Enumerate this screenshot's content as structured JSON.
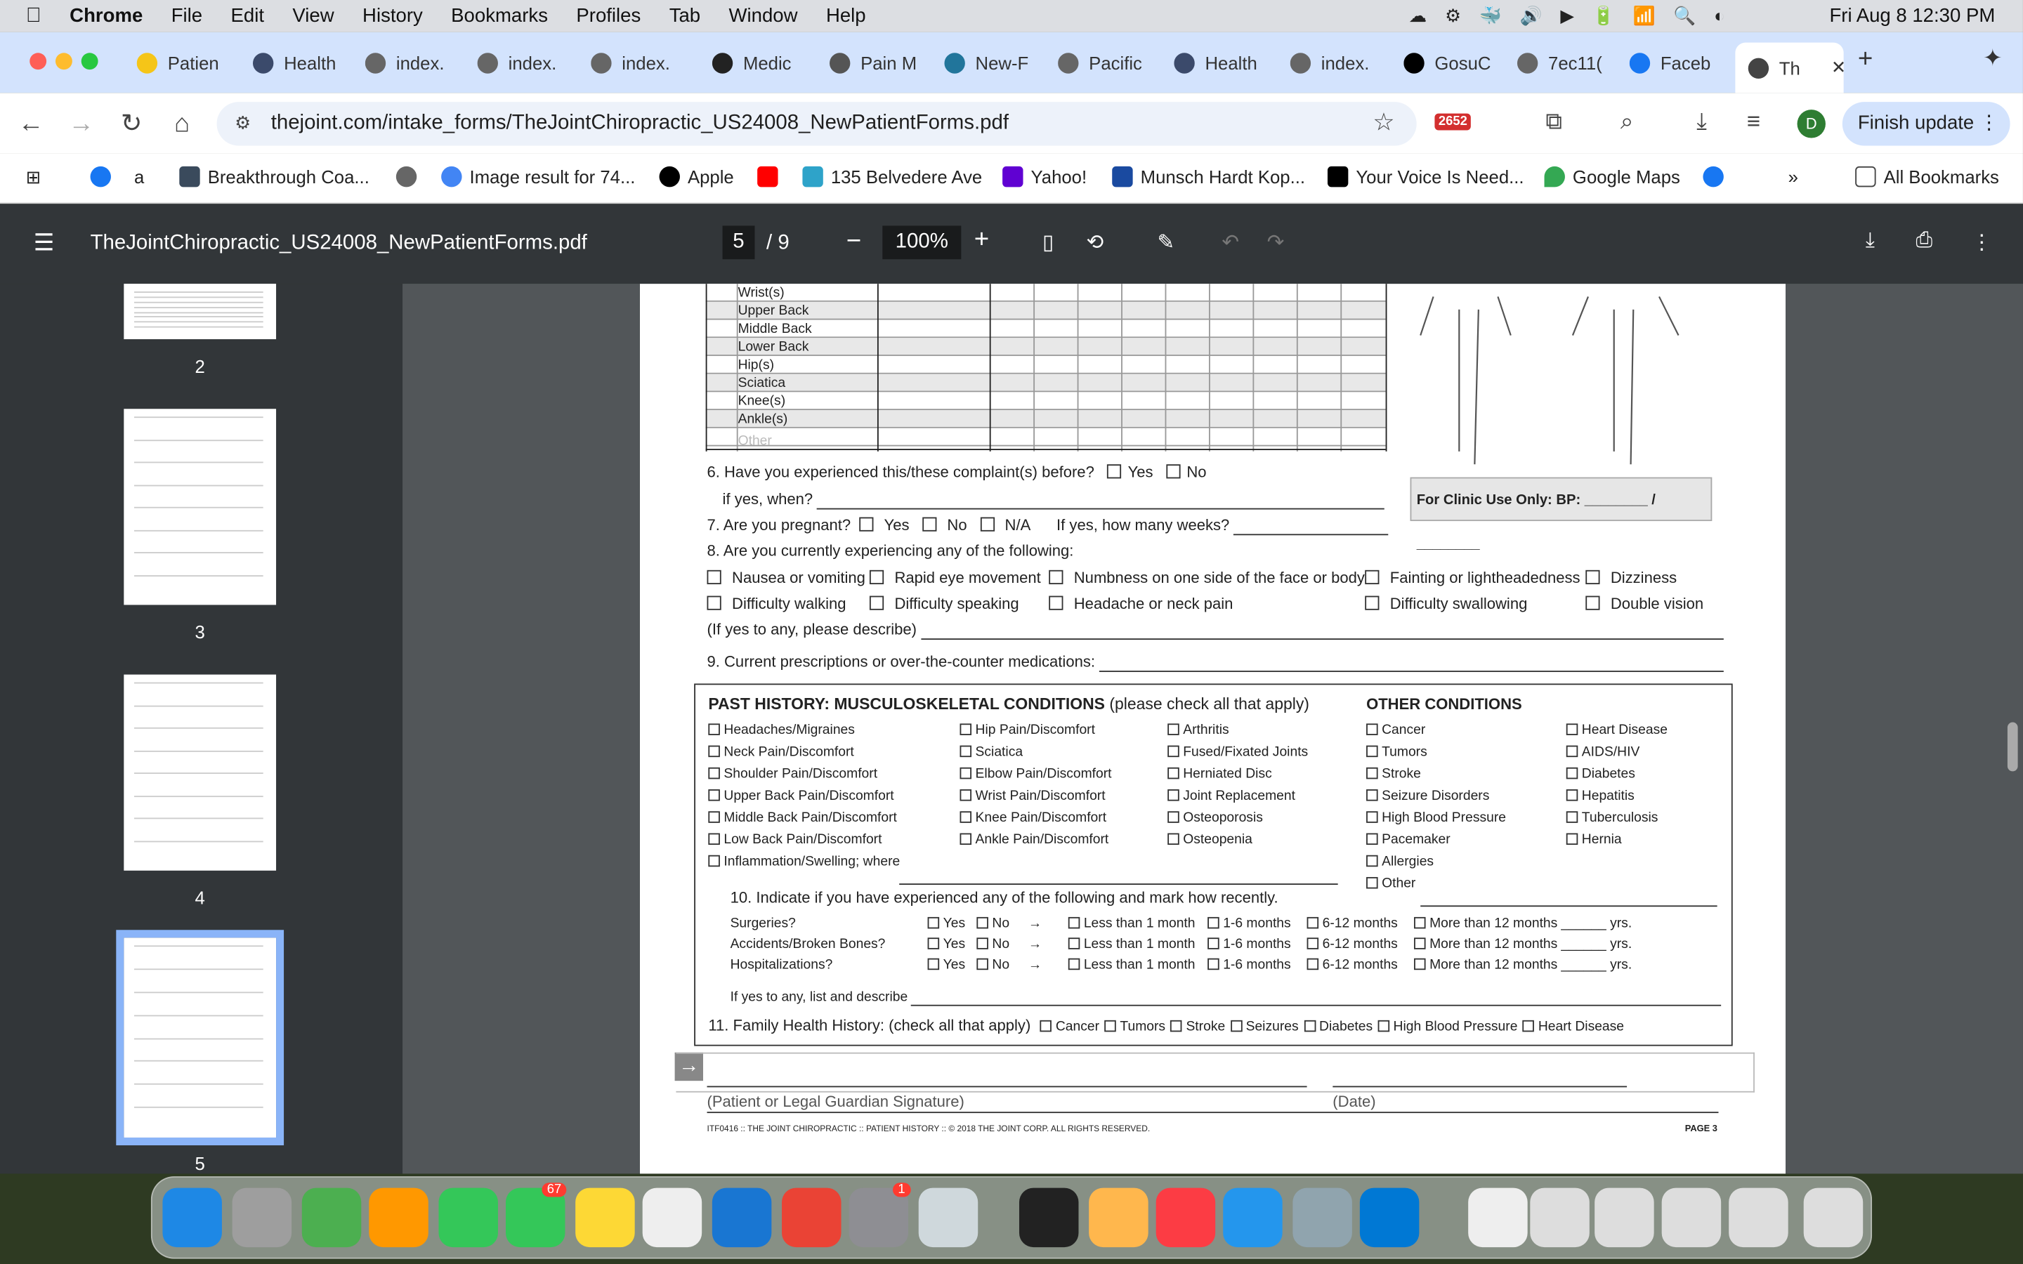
{
  "menubar": {
    "app": "Chrome",
    "items": [
      "File",
      "Edit",
      "View",
      "History",
      "Bookmarks",
      "Profiles",
      "Tab",
      "Window",
      "Help"
    ],
    "clock": "Fri Aug 8  12:30 PM"
  },
  "tabs": [
    {
      "label": "Patien",
      "color": "#f5c518"
    },
    {
      "label": "Health",
      "color": "#3b4a6b"
    },
    {
      "label": "index.",
      "color": "#666"
    },
    {
      "label": "index.",
      "color": "#666"
    },
    {
      "label": "index.",
      "color": "#666"
    },
    {
      "label": "Medic",
      "color": "#222"
    },
    {
      "label": "Pain M",
      "color": "#555"
    },
    {
      "label": "New-F",
      "color": "#21759b"
    },
    {
      "label": "Pacific",
      "color": "#666"
    },
    {
      "label": "Health",
      "color": "#3b4a6b"
    },
    {
      "label": "index.",
      "color": "#666"
    },
    {
      "label": "GosuC",
      "color": "#000"
    },
    {
      "label": "7ec11(",
      "color": "#666"
    },
    {
      "label": "Faceb",
      "color": "#1877f2"
    },
    {
      "label": "Th",
      "color": "#444"
    }
  ],
  "address": {
    "url": "thejoint.com/intake_forms/TheJointChiropractic_US24008_NewPatientForms.pdf",
    "ext_badge": "2652",
    "update_btn": "Finish update",
    "profile": "D"
  },
  "bookmarks": [
    "Breakthrough Coa...",
    "Image result for 74...",
    "Apple",
    "135 Belvedere Ave",
    "Yahoo!",
    "Munsch Hardt Kop...",
    "Your Voice Is Need...",
    "Google Maps"
  ],
  "bookmarks_all": "All Bookmarks",
  "pdf": {
    "filename": "TheJointChiropractic_US24008_NewPatientForms.pdf",
    "page": "5",
    "total": "/  9",
    "zoom": "100%"
  },
  "thumbs": [
    "2",
    "3",
    "4",
    "5"
  ],
  "form": {
    "body_rows": [
      "Wrist(s)",
      "Upper Back",
      "Middle Back",
      "Lower Back",
      "Hip(s)",
      "Sciatica",
      "Knee(s)",
      "Ankle(s)",
      "Other"
    ],
    "q6": "6. Have you experienced this/these complaint(s) before?",
    "yes": "Yes",
    "no": "No",
    "q6b": "if yes, when?",
    "q7": "7. Are you pregnant?",
    "na": "N/A",
    "q7b": "If yes, how many weeks?",
    "clinic": "For Clinic Use Only:   BP: ________ / ________",
    "q8": "8. Are you currently experiencing any of the following:",
    "q8_items": [
      "Nausea or vomiting",
      "Rapid eye movement",
      "Numbness on one side of the face or body",
      "Fainting or lightheadedness",
      "Dizziness",
      "Difficulty walking",
      "Difficulty speaking",
      "Headache or neck pain",
      "Difficulty swallowing",
      "Double vision"
    ],
    "q8b": "(If yes to any, please describe)",
    "q9": "9. Current prescriptions or over-the-counter medications:",
    "past_title": "PAST HISTORY",
    "past_sub": ": MUSCULOSKELETAL CONDITIONS",
    "past_note": " (please check all that apply)",
    "other_title": "OTHER CONDITIONS",
    "col1": [
      "Headaches/Migraines",
      "Neck Pain/Discomfort",
      "Shoulder Pain/Discomfort",
      "Upper Back Pain/Discomfort",
      "Middle Back Pain/Discomfort",
      "Low Back Pain/Discomfort",
      "Inflammation/Swelling; where"
    ],
    "col2": [
      "Hip Pain/Discomfort",
      "Sciatica",
      "Elbow Pain/Discomfort",
      "Wrist Pain/Discomfort",
      "Knee Pain/Discomfort",
      "Ankle Pain/Discomfort"
    ],
    "col3": [
      "Arthritis",
      "Fused/Fixated Joints",
      "Herniated Disc",
      "Joint Replacement",
      "Osteoporosis",
      "Osteopenia"
    ],
    "col4": [
      "Cancer",
      "Tumors",
      "Stroke",
      "Seizure Disorders",
      "High Blood Pressure",
      "Pacemaker",
      "Allergies",
      "Other"
    ],
    "col5": [
      "Heart Disease",
      "AIDS/HIV",
      "Diabetes",
      "Hepatitis",
      "Tuberculosis",
      "Hernia"
    ],
    "q10": "10. Indicate if you have experienced any of the following and mark how recently.",
    "q10_rows": [
      "Surgeries?",
      "Accidents/Broken Bones?",
      "Hospitalizations?"
    ],
    "q10_opts": [
      "Less than 1 month",
      "1-6 months",
      "6-12 months",
      "More than 12 months"
    ],
    "yrs": "______ yrs.",
    "q10b": "If yes to any, list and describe",
    "q11": "11. Family Health History: (check all that apply)",
    "q11_items": [
      "Cancer",
      "Tumors",
      "Stroke",
      "Seizures",
      "Diabetes",
      "High Blood Pressure",
      "Heart Disease"
    ],
    "sig": "(Patient or Legal Guardian Signature)",
    "date": "(Date)",
    "footer": "ITF0416   ::   THE JOINT CHIROPRACTIC   ::   PATIENT HISTORY   ::   © 2018 THE JOINT CORP. ALL RIGHTS RESERVED.",
    "pagenum": "PAGE 3"
  },
  "dock_badges": {
    "messages": "67",
    "settings": "1"
  }
}
